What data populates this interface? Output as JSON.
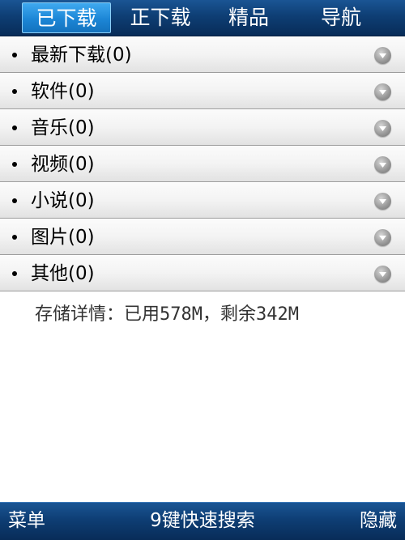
{
  "tabs": [
    {
      "label": "已下载",
      "active": true
    },
    {
      "label": "正下载",
      "active": false
    },
    {
      "label": "精品",
      "active": false
    },
    {
      "label": "导航",
      "active": false
    }
  ],
  "categories": [
    {
      "label": "最新下载(0)"
    },
    {
      "label": "软件(0)"
    },
    {
      "label": "音乐(0)"
    },
    {
      "label": "视频(0)"
    },
    {
      "label": "小说(0)"
    },
    {
      "label": "图片(0)"
    },
    {
      "label": "其他(0)"
    }
  ],
  "storage": {
    "text": "存储详情：已用578M，剩余342M"
  },
  "softkeys": {
    "left": "菜单",
    "center": "9键快速搜索",
    "right": "隐藏"
  },
  "icons": {
    "bullet": "bullet-dot-icon",
    "expand": "chevron-down-icon"
  },
  "colors": {
    "bar": "#0e3e74",
    "active_tab": "#1c86d6",
    "text": "#000000"
  }
}
